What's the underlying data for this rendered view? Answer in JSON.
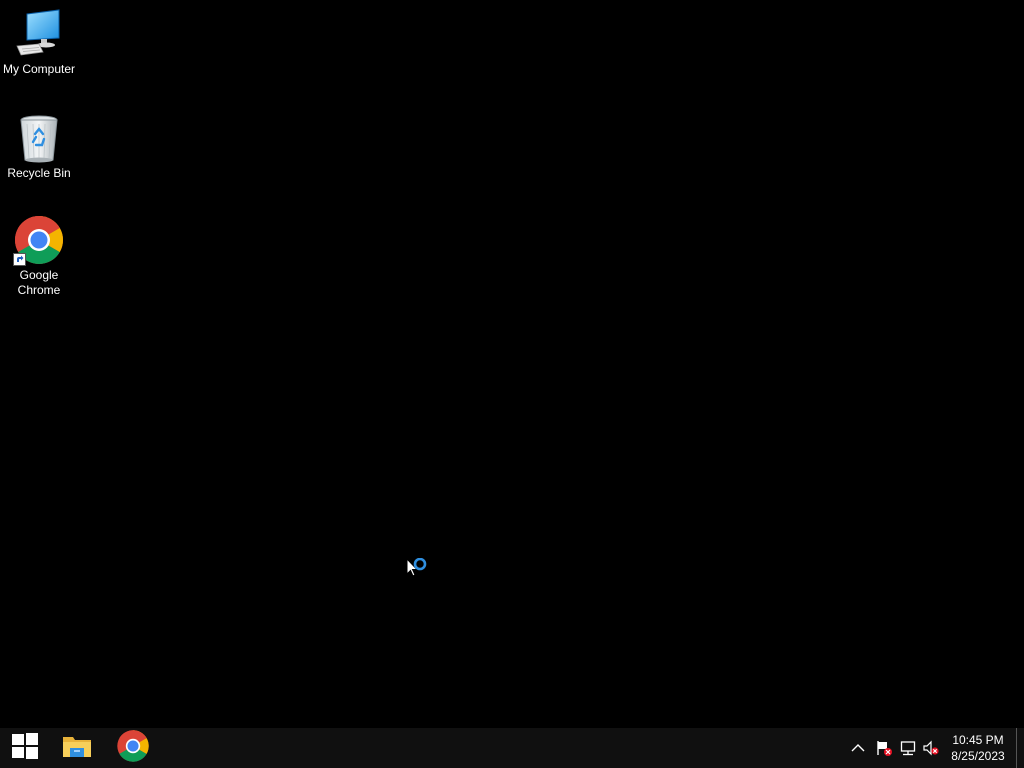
{
  "desktop": {
    "icons": [
      {
        "label": "My Computer",
        "icon": "computer-icon"
      },
      {
        "label": "Recycle Bin",
        "icon": "recycle-bin-icon"
      },
      {
        "label": "Google Chrome",
        "icon": "chrome-icon"
      }
    ]
  },
  "taskbar": {
    "pinned": [
      {
        "name": "Start",
        "icon": "windows-logo-icon"
      },
      {
        "name": "File Explorer",
        "icon": "folder-icon"
      },
      {
        "name": "Google Chrome",
        "icon": "chrome-icon"
      }
    ],
    "tray": {
      "icons": [
        "chevron-up-icon",
        "action-center-flag-icon",
        "network-icon",
        "volume-muted-icon"
      ]
    },
    "clock": {
      "time": "10:45 PM",
      "date": "8/25/2023"
    }
  },
  "colors": {
    "desktop_background": "#000000",
    "taskbar_background": "#101010",
    "accent_blue": "#2f8fe0",
    "chrome_red": "#db4437",
    "chrome_green": "#0f9d58",
    "chrome_yellow": "#f4b400",
    "chrome_blue": "#4285f4"
  }
}
